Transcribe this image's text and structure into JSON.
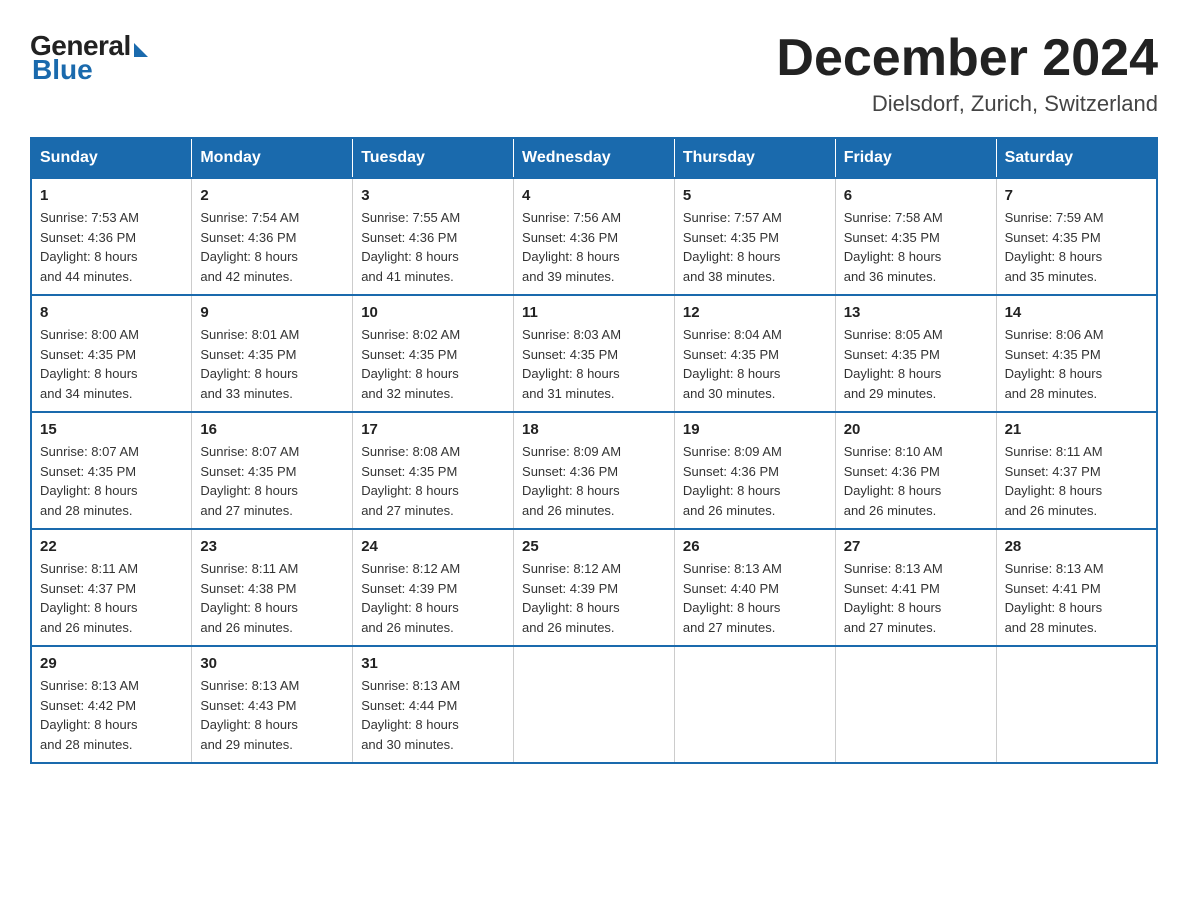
{
  "logo": {
    "general": "General",
    "blue": "Blue"
  },
  "title": "December 2024",
  "location": "Dielsdorf, Zurich, Switzerland",
  "days_of_week": [
    "Sunday",
    "Monday",
    "Tuesday",
    "Wednesday",
    "Thursday",
    "Friday",
    "Saturday"
  ],
  "weeks": [
    [
      {
        "day": "1",
        "sunrise": "7:53 AM",
        "sunset": "4:36 PM",
        "daylight": "8 hours and 44 minutes."
      },
      {
        "day": "2",
        "sunrise": "7:54 AM",
        "sunset": "4:36 PM",
        "daylight": "8 hours and 42 minutes."
      },
      {
        "day": "3",
        "sunrise": "7:55 AM",
        "sunset": "4:36 PM",
        "daylight": "8 hours and 41 minutes."
      },
      {
        "day": "4",
        "sunrise": "7:56 AM",
        "sunset": "4:36 PM",
        "daylight": "8 hours and 39 minutes."
      },
      {
        "day": "5",
        "sunrise": "7:57 AM",
        "sunset": "4:35 PM",
        "daylight": "8 hours and 38 minutes."
      },
      {
        "day": "6",
        "sunrise": "7:58 AM",
        "sunset": "4:35 PM",
        "daylight": "8 hours and 36 minutes."
      },
      {
        "day": "7",
        "sunrise": "7:59 AM",
        "sunset": "4:35 PM",
        "daylight": "8 hours and 35 minutes."
      }
    ],
    [
      {
        "day": "8",
        "sunrise": "8:00 AM",
        "sunset": "4:35 PM",
        "daylight": "8 hours and 34 minutes."
      },
      {
        "day": "9",
        "sunrise": "8:01 AM",
        "sunset": "4:35 PM",
        "daylight": "8 hours and 33 minutes."
      },
      {
        "day": "10",
        "sunrise": "8:02 AM",
        "sunset": "4:35 PM",
        "daylight": "8 hours and 32 minutes."
      },
      {
        "day": "11",
        "sunrise": "8:03 AM",
        "sunset": "4:35 PM",
        "daylight": "8 hours and 31 minutes."
      },
      {
        "day": "12",
        "sunrise": "8:04 AM",
        "sunset": "4:35 PM",
        "daylight": "8 hours and 30 minutes."
      },
      {
        "day": "13",
        "sunrise": "8:05 AM",
        "sunset": "4:35 PM",
        "daylight": "8 hours and 29 minutes."
      },
      {
        "day": "14",
        "sunrise": "8:06 AM",
        "sunset": "4:35 PM",
        "daylight": "8 hours and 28 minutes."
      }
    ],
    [
      {
        "day": "15",
        "sunrise": "8:07 AM",
        "sunset": "4:35 PM",
        "daylight": "8 hours and 28 minutes."
      },
      {
        "day": "16",
        "sunrise": "8:07 AM",
        "sunset": "4:35 PM",
        "daylight": "8 hours and 27 minutes."
      },
      {
        "day": "17",
        "sunrise": "8:08 AM",
        "sunset": "4:35 PM",
        "daylight": "8 hours and 27 minutes."
      },
      {
        "day": "18",
        "sunrise": "8:09 AM",
        "sunset": "4:36 PM",
        "daylight": "8 hours and 26 minutes."
      },
      {
        "day": "19",
        "sunrise": "8:09 AM",
        "sunset": "4:36 PM",
        "daylight": "8 hours and 26 minutes."
      },
      {
        "day": "20",
        "sunrise": "8:10 AM",
        "sunset": "4:36 PM",
        "daylight": "8 hours and 26 minutes."
      },
      {
        "day": "21",
        "sunrise": "8:11 AM",
        "sunset": "4:37 PM",
        "daylight": "8 hours and 26 minutes."
      }
    ],
    [
      {
        "day": "22",
        "sunrise": "8:11 AM",
        "sunset": "4:37 PM",
        "daylight": "8 hours and 26 minutes."
      },
      {
        "day": "23",
        "sunrise": "8:11 AM",
        "sunset": "4:38 PM",
        "daylight": "8 hours and 26 minutes."
      },
      {
        "day": "24",
        "sunrise": "8:12 AM",
        "sunset": "4:39 PM",
        "daylight": "8 hours and 26 minutes."
      },
      {
        "day": "25",
        "sunrise": "8:12 AM",
        "sunset": "4:39 PM",
        "daylight": "8 hours and 26 minutes."
      },
      {
        "day": "26",
        "sunrise": "8:13 AM",
        "sunset": "4:40 PM",
        "daylight": "8 hours and 27 minutes."
      },
      {
        "day": "27",
        "sunrise": "8:13 AM",
        "sunset": "4:41 PM",
        "daylight": "8 hours and 27 minutes."
      },
      {
        "day": "28",
        "sunrise": "8:13 AM",
        "sunset": "4:41 PM",
        "daylight": "8 hours and 28 minutes."
      }
    ],
    [
      {
        "day": "29",
        "sunrise": "8:13 AM",
        "sunset": "4:42 PM",
        "daylight": "8 hours and 28 minutes."
      },
      {
        "day": "30",
        "sunrise": "8:13 AM",
        "sunset": "4:43 PM",
        "daylight": "8 hours and 29 minutes."
      },
      {
        "day": "31",
        "sunrise": "8:13 AM",
        "sunset": "4:44 PM",
        "daylight": "8 hours and 30 minutes."
      },
      null,
      null,
      null,
      null
    ]
  ],
  "labels": {
    "sunrise": "Sunrise: ",
    "sunset": "Sunset: ",
    "daylight": "Daylight: "
  }
}
